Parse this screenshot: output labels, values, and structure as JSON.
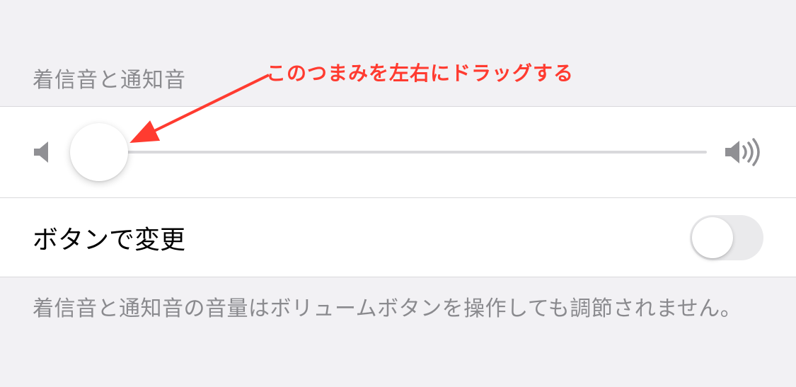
{
  "section": {
    "header": "着信音と通知音",
    "footer": "着信音と通知音の音量はボリュームボタンを操作しても調節されません。"
  },
  "slider": {
    "value_percent": 5
  },
  "toggle": {
    "label": "ボタンで変更",
    "state": "off"
  },
  "annotation": {
    "text": "このつまみを左右にドラッグする",
    "color": "#ff3b30"
  },
  "icons": {
    "speaker_low": "speaker-low-icon",
    "speaker_high": "speaker-high-icon"
  }
}
